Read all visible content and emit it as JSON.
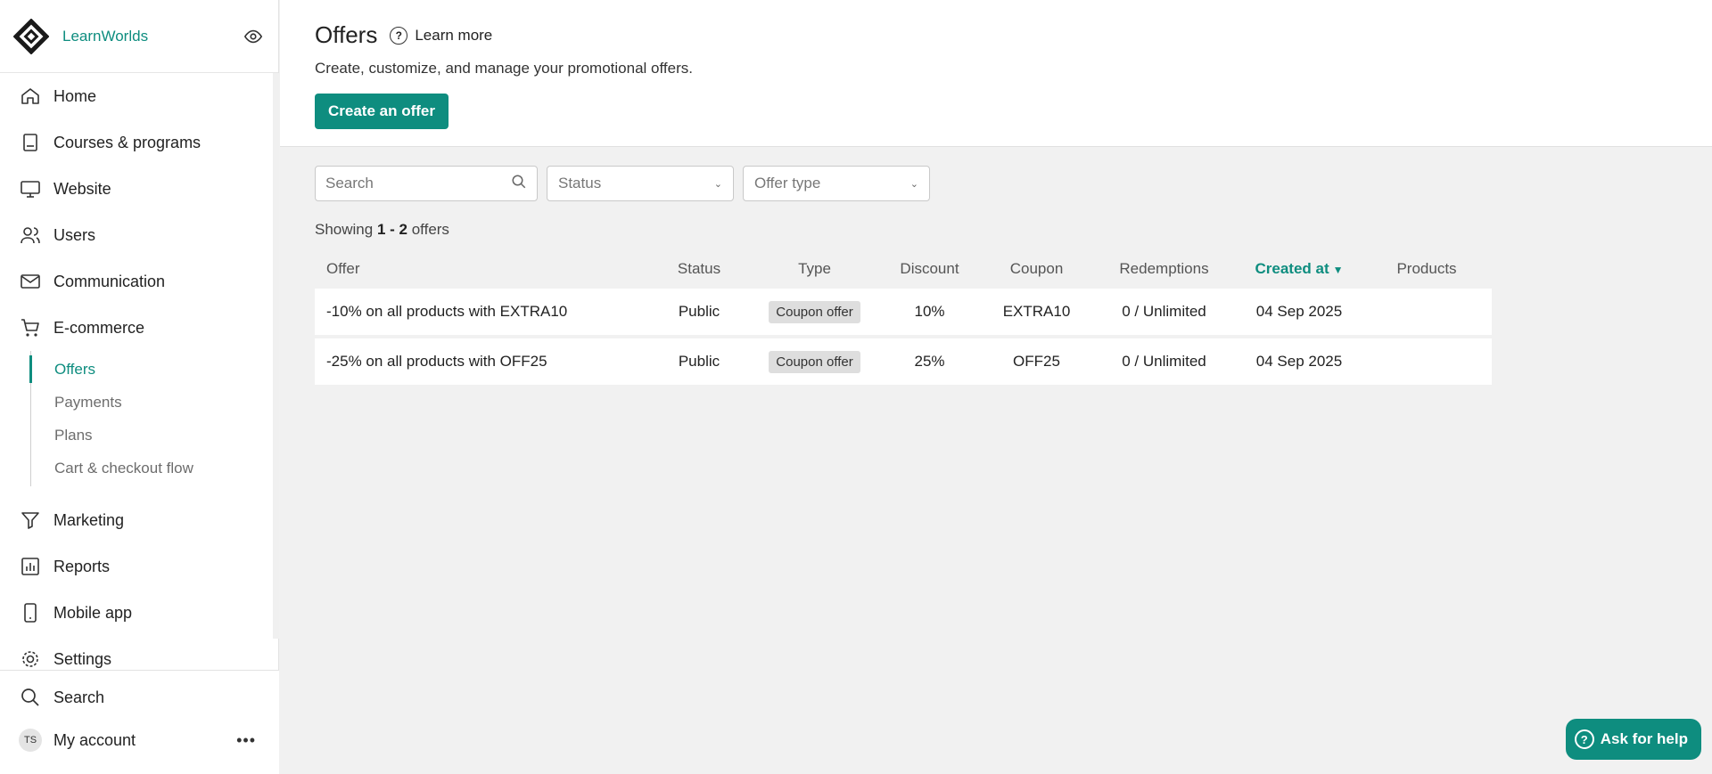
{
  "sidebar": {
    "brand": "LearnWorlds",
    "items": [
      {
        "label": "Home",
        "icon": "home-icon"
      },
      {
        "label": "Courses & programs",
        "icon": "book-icon"
      },
      {
        "label": "Website",
        "icon": "monitor-icon"
      },
      {
        "label": "Users",
        "icon": "users-icon"
      },
      {
        "label": "Communication",
        "icon": "mail-icon"
      },
      {
        "label": "E-commerce",
        "icon": "cart-icon"
      }
    ],
    "ecommerce_sub": [
      {
        "label": "Offers",
        "active": true
      },
      {
        "label": "Payments"
      },
      {
        "label": "Plans"
      },
      {
        "label": "Cart & checkout flow"
      }
    ],
    "items_after": [
      {
        "label": "Marketing",
        "icon": "funnel-icon"
      },
      {
        "label": "Reports",
        "icon": "chart-icon"
      },
      {
        "label": "Mobile app",
        "icon": "phone-icon"
      },
      {
        "label": "Settings",
        "icon": "gear-icon"
      }
    ],
    "bottom": {
      "search_label": "Search",
      "account_label": "My account",
      "avatar_initials": "TS"
    }
  },
  "header": {
    "title": "Offers",
    "learn_more": "Learn more",
    "subtitle": "Create, customize, and manage your promotional offers.",
    "create_button": "Create an offer"
  },
  "filters": {
    "search_placeholder": "Search",
    "status_placeholder": "Status",
    "offer_type_placeholder": "Offer type"
  },
  "showing": {
    "prefix": "Showing",
    "range": "1 - 2",
    "suffix": "offers"
  },
  "table": {
    "columns": [
      "Offer",
      "Status",
      "Type",
      "Discount",
      "Coupon",
      "Redemptions",
      "Created at",
      "Products"
    ],
    "sorted_column": "Created at",
    "rows": [
      {
        "offer": "-10% on all products with EXTRA10",
        "status": "Public",
        "type": "Coupon offer",
        "discount": "10%",
        "coupon": "EXTRA10",
        "redemptions": "0 / Unlimited",
        "created": "04 Sep 2025",
        "products": ""
      },
      {
        "offer": "-25% on all products with OFF25",
        "status": "Public",
        "type": "Coupon offer",
        "discount": "25%",
        "coupon": "OFF25",
        "redemptions": "0 / Unlimited",
        "created": "04 Sep 2025",
        "products": ""
      }
    ]
  },
  "help_button": "Ask for help",
  "colors": {
    "accent": "#0e8d7f",
    "background": "#f1f1f1",
    "badge": "#dedede"
  }
}
